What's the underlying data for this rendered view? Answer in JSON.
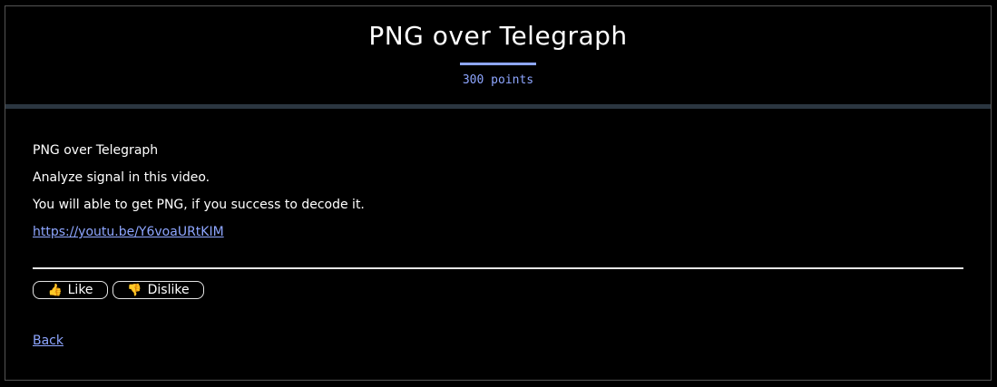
{
  "header": {
    "title": "PNG over Telegraph",
    "points": "300 points"
  },
  "description": {
    "lines": [
      "PNG over Telegraph",
      "Analyze signal in this video.",
      "You will able to get PNG, if you success to decode it."
    ],
    "link": "https://youtu.be/Y6voaURtKIM"
  },
  "votes": {
    "like_label": "Like",
    "dislike_label": "Dislike",
    "like_icon": "thumbs-up-icon",
    "dislike_icon": "thumbs-down-icon"
  },
  "nav": {
    "back_label": "Back"
  },
  "colors": {
    "accent": "#8ea6ff",
    "background": "#000000",
    "divider": "#2b3640"
  }
}
